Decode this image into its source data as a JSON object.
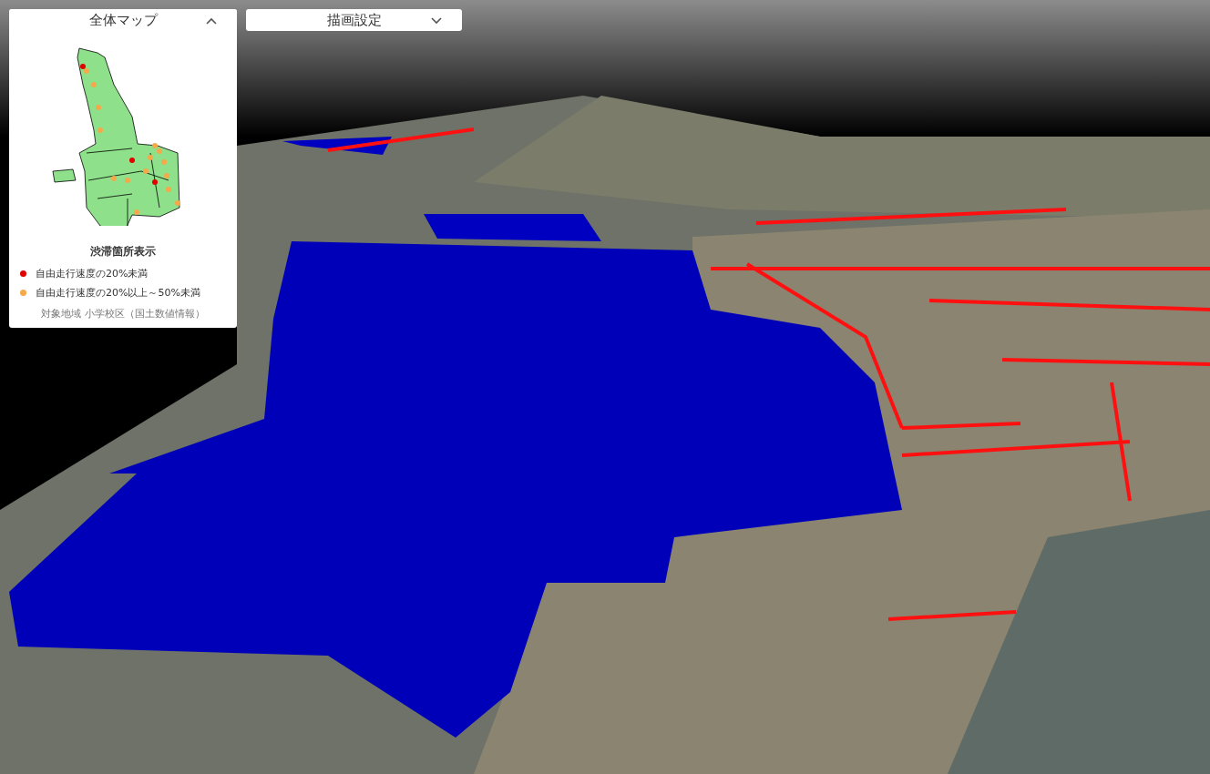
{
  "overview_panel": {
    "title": "全体マップ",
    "expanded": true,
    "legend_title": "渋滞箇所表示",
    "legend": [
      {
        "label": "自由走行速度の20%未満",
        "color": "#e00000"
      },
      {
        "label": "自由走行速度の20%以上～50%未満",
        "color": "#f5a94a"
      }
    ],
    "note": "対象地域 小学校区（国土数値情報）"
  },
  "settings_panel": {
    "title": "描画設定",
    "expanded": false
  }
}
